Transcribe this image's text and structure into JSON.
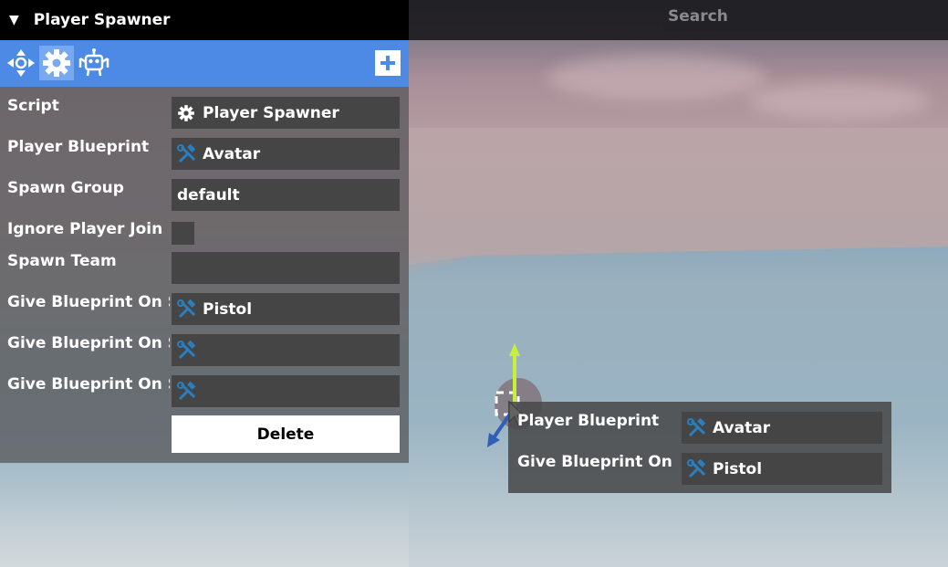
{
  "panel": {
    "title": "Player Spawner",
    "collapse_glyph": "▼",
    "toolbar_icons": [
      "transform-icon",
      "gear-icon",
      "robot-icon"
    ],
    "add_glyph": "+"
  },
  "search": {
    "placeholder": "Search"
  },
  "properties": [
    {
      "label": "Script",
      "value": "Player Spawner",
      "icon": "gear-icon"
    },
    {
      "label": "Player Blueprint",
      "value": "Avatar",
      "icon": "wrench-hammer-icon"
    },
    {
      "label": "Spawn Group",
      "value": "default",
      "icon": ""
    },
    {
      "label": "Ignore Player Join",
      "value": "",
      "checked": false
    },
    {
      "label": "Spawn Team",
      "value": "",
      "icon": ""
    },
    {
      "label": "Give Blueprint On S",
      "value": "Pistol",
      "icon": "wrench-hammer-icon"
    },
    {
      "label": "Give Blueprint On S",
      "value": "",
      "icon": "wrench-hammer-icon"
    },
    {
      "label": "Give Blueprint On S",
      "value": "",
      "icon": "wrench-hammer-icon"
    }
  ],
  "delete_label": "Delete",
  "popup": {
    "rows": [
      {
        "label": "Player Blueprint",
        "value": "Avatar",
        "icon": "wrench-hammer-icon"
      },
      {
        "label": "Give Blueprint On S",
        "value": "Pistol",
        "icon": "wrench-hammer-icon"
      }
    ]
  },
  "colors": {
    "toolbar": "#4d8ae6",
    "tool_icon": "#2a7fc0",
    "panel_bg": "#5a5a5c",
    "field_bg": "#454545"
  }
}
